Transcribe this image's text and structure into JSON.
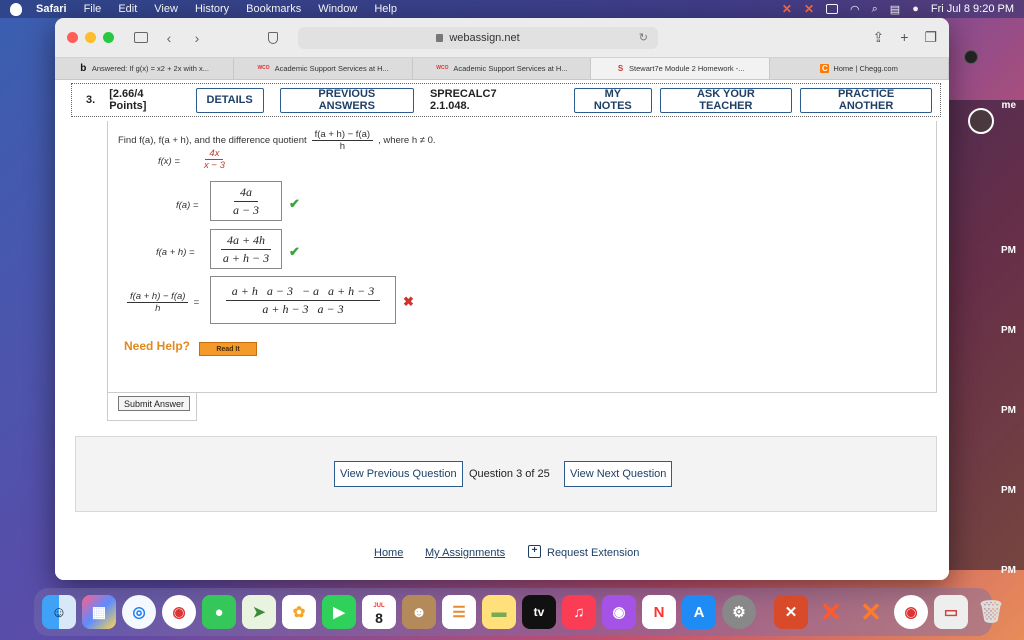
{
  "menubar": {
    "app": "Safari",
    "items": [
      "File",
      "Edit",
      "View",
      "History",
      "Bookmarks",
      "Window",
      "Help"
    ],
    "clock": "Fri Jul 8  9:20 PM"
  },
  "browser": {
    "url": "webassign.net",
    "tabs": [
      {
        "icon": "b",
        "label": "Answered: If g(x) = x2 + 2x with x..."
      },
      {
        "icon": "WCO",
        "label": "Academic Support Services at H..."
      },
      {
        "icon": "WCO",
        "label": "Academic Support Services at H..."
      },
      {
        "icon": "S",
        "label": "Stewart7e Module 2 Homework -..."
      },
      {
        "icon": "C",
        "label": "Home | Chegg.com"
      }
    ]
  },
  "question": {
    "number": "3.",
    "points": "[2.66/4 Points]",
    "details_label": "DETAILS",
    "previous_answers_label": "PREVIOUS ANSWERS",
    "code": "SPRECALC7 2.1.048.",
    "my_notes_label": "MY NOTES",
    "ask_teacher_label": "ASK YOUR TEACHER",
    "practice_label": "PRACTICE ANOTHER",
    "prompt_prefix": "Find f(a), f(a + h), and the difference quotient",
    "dq_num": "f(a + h) − f(a)",
    "dq_den": "h",
    "prompt_suffix": ", where h ≠ 0.",
    "fx_label": "f(x) =",
    "fx_num": "4x",
    "fx_den": "x − 3",
    "fa_label": "f(a) =",
    "fa_num": "4a",
    "fa_den": "a − 3",
    "fah_label": "f(a + h) =",
    "fah_num": "4a + 4h",
    "fah_den": "a + h − 3",
    "dq_eq": "=",
    "dq_answer_num": "a + h   a − 3   − a   a + h − 3",
    "dq_answer_den": "a + h − 3   a − 3",
    "need_help": "Need Help?",
    "read_it": "Read It",
    "submit_label": "Submit Answer"
  },
  "navigation": {
    "prev_label": "View Previous Question",
    "counter": "Question 3 of 25",
    "next_label": "View Next Question"
  },
  "footer": {
    "home": "Home",
    "assignments": "My Assignments",
    "extension": "Request Extension"
  },
  "desktop": {
    "labels": [
      "me",
      "PM",
      "PM",
      "PM",
      "PM",
      "PM"
    ]
  },
  "dock": {
    "calendar_month": "JUL",
    "calendar_day": "8",
    "tv_label": "tv"
  }
}
